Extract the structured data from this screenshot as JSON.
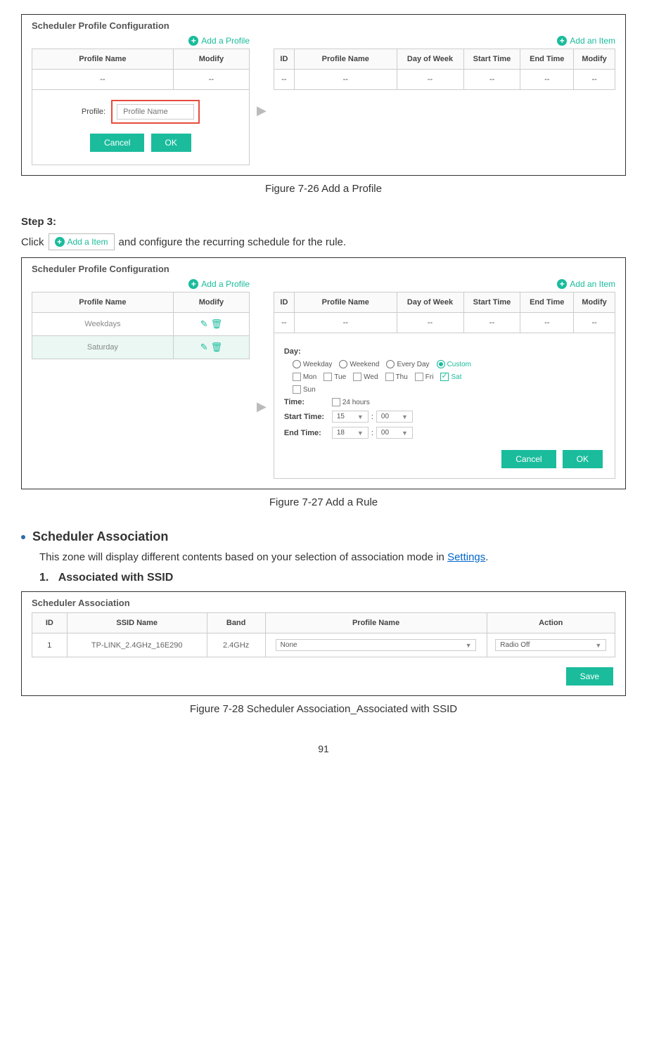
{
  "fig1": {
    "panel_title": "Scheduler Profile Configuration",
    "add_profile": "Add a Profile",
    "add_item": "Add an Item",
    "left_headers": [
      "Profile Name",
      "Modify"
    ],
    "right_headers": [
      "ID",
      "Profile Name",
      "Day of Week",
      "Start Time",
      "End Time",
      "Modify"
    ],
    "dash": "--",
    "profile_label": "Profile:",
    "profile_placeholder": "Profile Name",
    "cancel": "Cancel",
    "ok": "OK",
    "caption": "Figure 7-26 Add a Profile"
  },
  "step3": {
    "label": "Step 3:",
    "pre": "Click",
    "link": "Add a Item",
    "post": "and configure the recurring schedule for the rule."
  },
  "fig2": {
    "panel_title": "Scheduler Profile Configuration",
    "add_profile": "Add a Profile",
    "add_item": "Add an Item",
    "left_headers": [
      "Profile Name",
      "Modify"
    ],
    "left_rows": [
      "Weekdays",
      "Saturday"
    ],
    "right_headers": [
      "ID",
      "Profile Name",
      "Day of Week",
      "Start Time",
      "End Time",
      "Modify"
    ],
    "dash": "--",
    "day_label": "Day:",
    "day_opts": [
      "Weekday",
      "Weekend",
      "Every Day",
      "Custom"
    ],
    "days": [
      "Mon",
      "Tue",
      "Wed",
      "Thu",
      "Fri",
      "Sat",
      "Sun"
    ],
    "time_label": "Time:",
    "h24": "24 hours",
    "start_label": "Start Time:",
    "start_h": "15",
    "start_m": "00",
    "end_label": "End Time:",
    "end_h": "18",
    "end_m": "00",
    "cancel": "Cancel",
    "ok": "OK",
    "caption": "Figure 7-27 Add a Rule"
  },
  "section": {
    "heading": "Scheduler Association",
    "body_pre": "This zone will display different contents based on your selection of association mode in ",
    "settings": "Settings",
    "body_post": ".",
    "sub_num": "1.",
    "sub_head": "Associated with SSID"
  },
  "fig3": {
    "panel_title": "Scheduler Association",
    "headers": [
      "ID",
      "SSID Name",
      "Band",
      "Profile Name",
      "Action"
    ],
    "row_id": "1",
    "row_ssid": "TP-LINK_2.4GHz_16E290",
    "row_band": "2.4GHz",
    "row_profile": "None",
    "row_action": "Radio Off",
    "save": "Save",
    "caption": "Figure 7-28 Scheduler Association_Associated with SSID"
  },
  "page_number": "91"
}
